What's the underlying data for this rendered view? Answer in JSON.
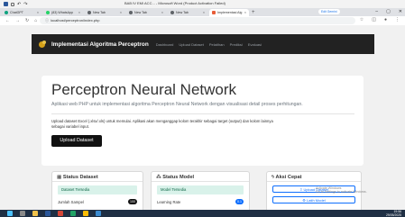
{
  "window": {
    "title": "BAB IV EMI ACC... - Microsoft Word (Product Activation Failed)"
  },
  "browser": {
    "tabs": [
      {
        "label": "ChatGPT",
        "active": false,
        "icon": "chatgpt-icon"
      },
      {
        "label": "(83) WhatsApp",
        "active": false,
        "icon": "whatsapp-icon"
      },
      {
        "label": "New Tab",
        "active": false,
        "icon": "newtab-icon"
      },
      {
        "label": "New Tab",
        "active": false,
        "icon": "newtab-icon"
      },
      {
        "label": "New Tab",
        "active": false,
        "icon": "newtab-icon"
      },
      {
        "label": "Implementasi Alg",
        "active": true,
        "icon": "page-icon"
      }
    ],
    "new_tab_symbol": "+",
    "edit_desktop": "Edit Gemini",
    "url": "localhost/perceptron/index.php",
    "win_controls": [
      "–",
      "▢",
      "✕"
    ]
  },
  "navbar": {
    "brand": "Implementasi Algoritma Perceptron",
    "links": [
      "Dashboard",
      "Upload Dataset",
      "Pelatihan",
      "Prediksi",
      "Evaluasi"
    ]
  },
  "hero": {
    "title": "Perceptron Neural Network",
    "lead": "Aplikasi web PHP untuk implementasi algoritma Perceptron Neural Network dengan visualisasi detail proses perhitungan.",
    "desc": "Upload dataset Excel (.xlsx/.xls) untuk memulai. Aplikasi akan menganggap kolom terakhir sebagai target (output) dan kolom lainnya sebagai variabel input.",
    "button": "Upload Dataset"
  },
  "cards": [
    {
      "title": "Status Dataset",
      "icon": "table-icon",
      "alert": "Dataset Tersedia",
      "row_label": "Jumlah Sampel",
      "badge": "100",
      "badge_color": "#111111"
    },
    {
      "title": "Status Model",
      "icon": "chart-icon",
      "alert": "Model Tersedia",
      "row_label": "Learning Rate",
      "badge": "0.1",
      "badge_color": "#0d6efd"
    },
    {
      "title": "Aksi Cepat",
      "icon": "lightning-icon",
      "buttons": [
        "Upload Dataset",
        "Latih Model"
      ]
    }
  ],
  "watermark": {
    "line1": "Activate Windows",
    "line2": "Go to Settings to activate Windows."
  },
  "taskbar": {
    "time": "19:56",
    "date": "29/05/2025"
  }
}
